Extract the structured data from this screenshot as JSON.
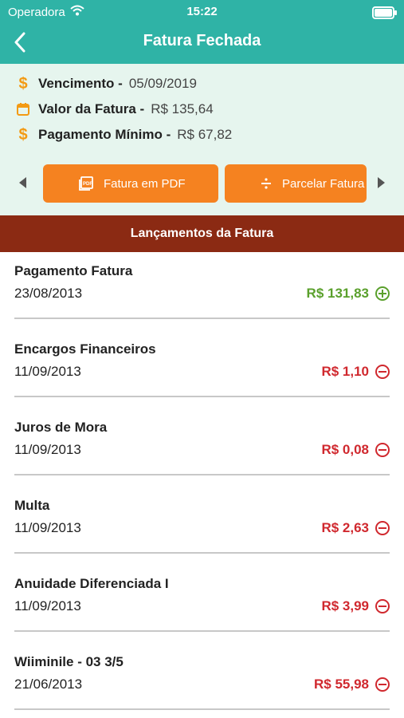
{
  "status_bar": {
    "carrier": "Operadora",
    "time": "15:22"
  },
  "header": {
    "title": "Fatura Fechada"
  },
  "info": {
    "vencimento": {
      "label": "Vencimento -",
      "value": "05/09/2019"
    },
    "valor": {
      "label": "Valor da Fatura -",
      "value": "R$ 135,64"
    },
    "minimo": {
      "label": "Pagamento Mínimo -",
      "value": "R$ 67,82"
    }
  },
  "actions": {
    "pdf_label": "Fatura em PDF",
    "parcelar_label": "Parcelar Fatura"
  },
  "section_title": "Lançamentos da Fatura",
  "colors": {
    "teal": "#2fb3a6",
    "orange": "#f58220",
    "section": "#8b2a13",
    "credit": "#5aa02c",
    "debit": "#d0282e"
  },
  "transactions": [
    {
      "name": "Pagamento Fatura",
      "date": "23/08/2013",
      "amount": "R$ 131,83",
      "type": "credit"
    },
    {
      "name": "Encargos Financeiros",
      "date": "11/09/2013",
      "amount": "R$ 1,10",
      "type": "debit"
    },
    {
      "name": "Juros de Mora",
      "date": "11/09/2013",
      "amount": "R$ 0,08",
      "type": "debit"
    },
    {
      "name": "Multa",
      "date": "11/09/2013",
      "amount": "R$ 2,63",
      "type": "debit"
    },
    {
      "name": "Anuidade Diferenciada I",
      "date": "11/09/2013",
      "amount": "R$ 3,99",
      "type": "debit"
    },
    {
      "name": "Wiiminile - 03 3/5",
      "date": "21/06/2013",
      "amount": "R$ 55,98",
      "type": "debit"
    }
  ]
}
